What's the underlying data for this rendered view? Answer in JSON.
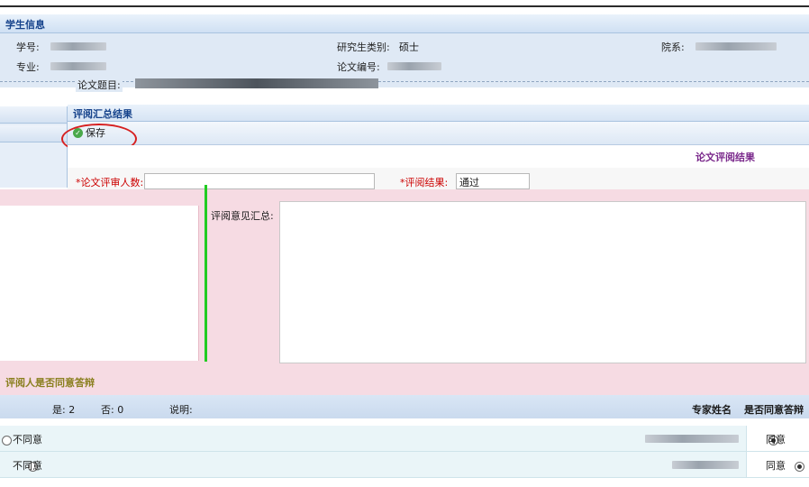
{
  "student_info": {
    "header": "学生信息",
    "student_id_label": "学号:",
    "major_label": "专业:",
    "grad_type_label": "研究生类别:",
    "grad_type_value": "硕士",
    "thesis_no_label": "论文编号:",
    "department_label": "院系:",
    "thesis_title_label": "论文题目:"
  },
  "summary": {
    "header": "评阅汇总结果",
    "save_label": "保存",
    "result_title": "论文评阅结果",
    "reviewer_count_label": "*论文评审人数:",
    "review_result_label": "*评阅结果:",
    "review_result_value": "通过",
    "comments_label": "评阅意见汇总:"
  },
  "defense": {
    "header": "评阅人是否同意答辩",
    "legend_yes": "是: 2",
    "legend_no": "否: 0",
    "legend_note": "说明:",
    "col_expert": "专家姓名",
    "col_agree": "是否同意答辩",
    "rows": [
      {
        "disagree_label": "不同意",
        "agree_label": "同意",
        "agree_selected": true
      },
      {
        "disagree_label": "不同意",
        "agree_label": "同意",
        "agree_selected": true
      }
    ]
  },
  "colors": {
    "header_text": "#15428b",
    "result_title": "#7b2a8c",
    "annotation_circle": "#d62020",
    "splitter": "#22cc22"
  }
}
